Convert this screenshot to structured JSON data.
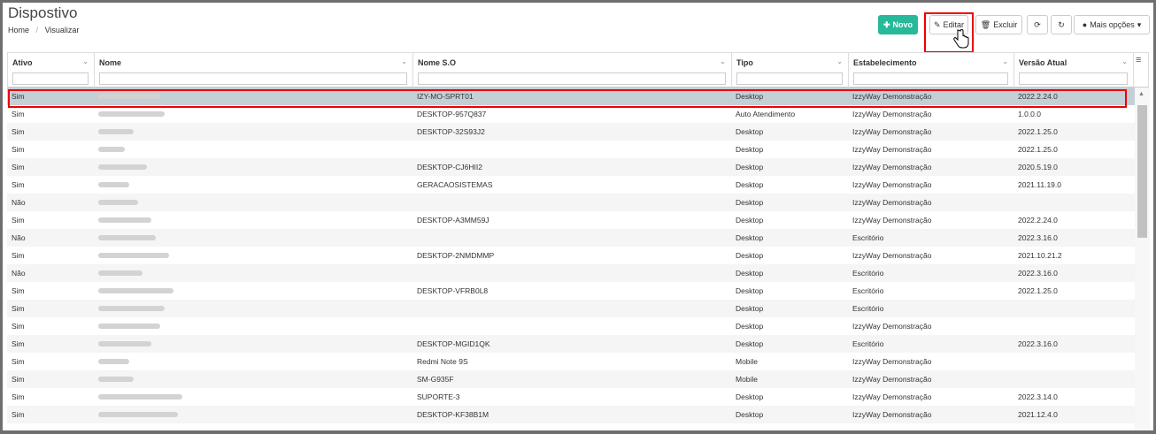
{
  "page": {
    "title": "Dispostivo"
  },
  "breadcrumb": {
    "home": "Home",
    "current": "Visualizar"
  },
  "toolbar": {
    "novo": "Novo",
    "editar": "Editar",
    "excluir": "Excluir",
    "mais": "Mais opções"
  },
  "columns": [
    "Ativo",
    "Nome",
    "Nome S.O",
    "Tipo",
    "Estabelecimento",
    "Versão Atual"
  ],
  "rows": [
    {
      "ativo": "Sim",
      "so": "IZY-MO-SPRT01",
      "tipo": "Desktop",
      "estab": "IzzyWay Demonstração",
      "versao": "2022.2.24.0"
    },
    {
      "ativo": "Sim",
      "so": "DESKTOP-957Q837",
      "tipo": "Auto Atendimento",
      "estab": "IzzyWay Demonstração",
      "versao": "1.0.0.0"
    },
    {
      "ativo": "Sim",
      "so": "DESKTOP-32S93J2",
      "tipo": "Desktop",
      "estab": "IzzyWay Demonstração",
      "versao": "2022.1.25.0"
    },
    {
      "ativo": "Sim",
      "so": "",
      "tipo": "Desktop",
      "estab": "IzzyWay Demonstração",
      "versao": "2022.1.25.0"
    },
    {
      "ativo": "Sim",
      "so": "DESKTOP-CJ6HII2",
      "tipo": "Desktop",
      "estab": "IzzyWay Demonstração",
      "versao": "2020.5.19.0"
    },
    {
      "ativo": "Sim",
      "so": "GERACAOSISTEMAS",
      "tipo": "Desktop",
      "estab": "IzzyWay Demonstração",
      "versao": "2021.11.19.0"
    },
    {
      "ativo": "Não",
      "so": "",
      "tipo": "Desktop",
      "estab": "IzzyWay Demonstração",
      "versao": ""
    },
    {
      "ativo": "Sim",
      "so": "DESKTOP-A3MM59J",
      "tipo": "Desktop",
      "estab": "IzzyWay Demonstração",
      "versao": "2022.2.24.0"
    },
    {
      "ativo": "Não",
      "so": "",
      "tipo": "Desktop",
      "estab": "Escritório",
      "versao": "2022.3.16.0"
    },
    {
      "ativo": "Sim",
      "so": "DESKTOP-2NMDMMP",
      "tipo": "Desktop",
      "estab": "IzzyWay Demonstração",
      "versao": "2021.10.21.2"
    },
    {
      "ativo": "Não",
      "so": "",
      "tipo": "Desktop",
      "estab": "Escritório",
      "versao": "2022.3.16.0"
    },
    {
      "ativo": "Sim",
      "so": "DESKTOP-VFRB0L8",
      "tipo": "Desktop",
      "estab": "Escritório",
      "versao": "2022.1.25.0"
    },
    {
      "ativo": "Sim",
      "so": "",
      "tipo": "Desktop",
      "estab": "Escritório",
      "versao": ""
    },
    {
      "ativo": "Sim",
      "so": "",
      "tipo": "Desktop",
      "estab": "IzzyWay Demonstração",
      "versao": ""
    },
    {
      "ativo": "Sim",
      "so": "DESKTOP-MGID1QK",
      "tipo": "Desktop",
      "estab": "Escritório",
      "versao": "2022.3.16.0"
    },
    {
      "ativo": "Sim",
      "so": "Redmi Note 9S",
      "tipo": "Mobile",
      "estab": "IzzyWay Demonstração",
      "versao": ""
    },
    {
      "ativo": "Sim",
      "so": "SM-G935F",
      "tipo": "Mobile",
      "estab": "IzzyWay Demonstração",
      "versao": ""
    },
    {
      "ativo": "Sim",
      "so": "SUPORTE-3",
      "tipo": "Desktop",
      "estab": "IzzyWay Demonstração",
      "versao": "2022.3.14.0"
    },
    {
      "ativo": "Sim",
      "so": "DESKTOP-KF38B1M",
      "tipo": "Desktop",
      "estab": "IzzyWay Demonstração",
      "versao": "2021.12.4.0"
    }
  ],
  "colors": {
    "accent": "#26b99a",
    "selected_row": "#c5cfd6",
    "highlight": "#e00000"
  }
}
